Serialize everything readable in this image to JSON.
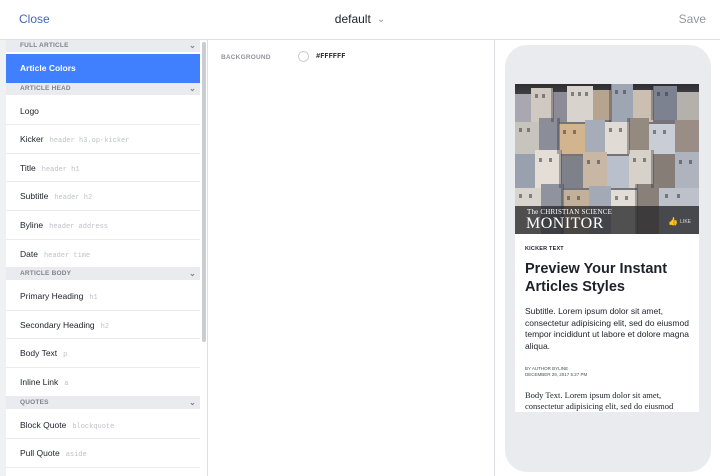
{
  "topbar": {
    "close_label": "Close",
    "style_name": "default",
    "save_label": "Save"
  },
  "sidebar": {
    "sections": [
      {
        "header": "FULL ARTICLE",
        "items": [
          {
            "label": "Article Colors",
            "hint": "",
            "active": true
          }
        ]
      },
      {
        "header": "ARTICLE HEAD",
        "items": [
          {
            "label": "Logo",
            "hint": ""
          },
          {
            "label": "Kicker",
            "hint": "header h3.op-kicker"
          },
          {
            "label": "Title",
            "hint": "header h1"
          },
          {
            "label": "Subtitle",
            "hint": "header h2"
          },
          {
            "label": "Byline",
            "hint": "header address"
          },
          {
            "label": "Date",
            "hint": "header time"
          }
        ]
      },
      {
        "header": "ARTICLE BODY",
        "items": [
          {
            "label": "Primary Heading",
            "hint": "h1"
          },
          {
            "label": "Secondary Heading",
            "hint": "h2"
          },
          {
            "label": "Body Text",
            "hint": "p"
          },
          {
            "label": "Inline Link",
            "hint": "a"
          }
        ]
      },
      {
        "header": "QUOTES",
        "items": [
          {
            "label": "Block Quote",
            "hint": "blockquote"
          },
          {
            "label": "Pull Quote",
            "hint": "aside"
          }
        ]
      }
    ]
  },
  "editor": {
    "background_label": "BACKGROUND",
    "background_value": "#FFFFFF"
  },
  "preview": {
    "masthead_small": "The CHRISTIAN SCIENCE",
    "masthead_big": "MONITOR",
    "like_label": "LIKE",
    "kicker": "KICKER TEXT",
    "title": "Preview Your Instant Articles Styles",
    "subtitle": "Subtitle. Lorem ipsum dolor sit amet, consectetur adipisicing elit, sed do eiusmod tempor incididunt ut labore et dolore magna aliqua.",
    "byline": "BY AUTHOR BYLINE",
    "date": "DECEMBER 29, 2017 5:27 PM",
    "body": "Body Text. Lorem ipsum dolor sit amet, consectetur adipisicing elit, sed do eiusmod"
  },
  "colors": {
    "accent": "#4080ff",
    "link": "#4267b2",
    "section_bg": "#e9ebee"
  }
}
